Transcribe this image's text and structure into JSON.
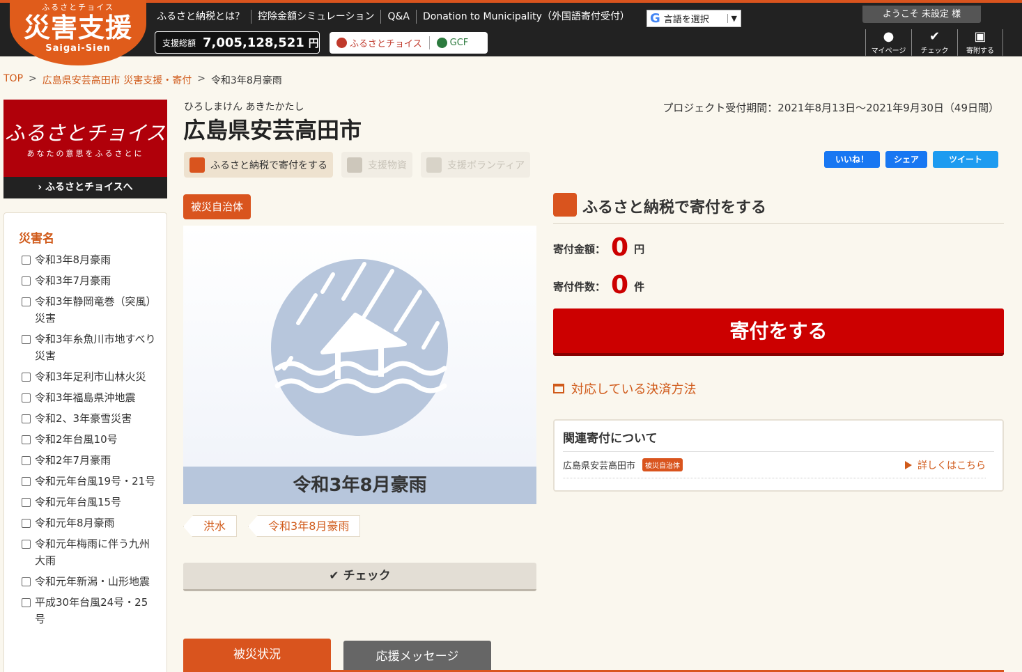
{
  "header": {
    "logo_small": "ふるさとチョイス",
    "logo_main": "災害支援",
    "logo_roman": "Saigai-Sien",
    "nav": [
      "ふるさと納税とは？",
      "控除金額シミュレーション",
      "Q&A",
      "Donation to Municipality（外国語寄付受付）"
    ],
    "language_select": "言語を選択",
    "total_label": "支援総額",
    "total_value": "7,005,128,521",
    "total_unit": "円",
    "brand_choice": "ふるさとチョイス",
    "brand_gcf": "GCF",
    "welcome": "ようこそ 未設定 様",
    "icon_buttons": [
      "マイページ",
      "チェック",
      "寄附する"
    ]
  },
  "breadcrumb": {
    "top": "TOP",
    "parent": "広島県安芸高田市 災害支援・寄付",
    "current": "令和3年8月豪雨",
    "sep": ">"
  },
  "sidebar": {
    "banner_title": "ふるさとチョイス",
    "banner_sub": "あなたの意思をふるさとに",
    "banner_link": "› ふるさとチョイスへ",
    "filter_title": "災害名",
    "disasters": [
      "令和3年8月豪雨",
      "令和3年7月豪雨",
      "令和3年静岡竜巻（突風）災害",
      "令和3年糸魚川市地すべり災害",
      "令和3年足利市山林火災",
      "令和3年福島県沖地震",
      "令和2、3年豪雪災害",
      "令和2年台風10号",
      "令和2年7月豪雨",
      "令和元年台風19号・21号",
      "令和元年台風15号",
      "令和元年8月豪雨",
      "令和元年梅雨に伴う九州大雨",
      "令和元年新潟・山形地震",
      "平成30年台風24号・25号"
    ]
  },
  "project": {
    "kana": "ひろしまけん あきたかたし",
    "municipality": "広島県安芸高田市",
    "period": "プロジェクト受付期間：2021年8月13日〜2021年9月30日（49日間）",
    "mode_tabs": [
      "ふるさと納税で寄付をする",
      "支援物資",
      "支援ボランティア"
    ],
    "social": [
      "いいね！",
      "シェア",
      "ツイート"
    ],
    "badge": "被災自治体",
    "caption": "令和3年8月豪雨",
    "tags": [
      "洪水",
      "令和3年8月豪雨"
    ],
    "check_label": "✔ チェック",
    "bottom_tabs": [
      "被災状況",
      "応援メッセージ"
    ]
  },
  "donation": {
    "heading": "ふるさと納税で寄付をする",
    "amount_label": "寄付金額：",
    "amount_value": "0",
    "amount_unit": "円",
    "count_label": "寄付件数：",
    "count_value": "0",
    "count_unit": "件",
    "button": "寄付をする",
    "payment_link": "対応している決済方法",
    "related_title": "関連寄付について",
    "related_name": "広島県安芸高田市",
    "related_badge": "被災自治体",
    "related_more": "詳しくはこちら"
  },
  "colors": {
    "accent": "#d9541e",
    "donate": "#cc0000",
    "header_bg": "#222222",
    "page_bg": "#faf7ee"
  }
}
